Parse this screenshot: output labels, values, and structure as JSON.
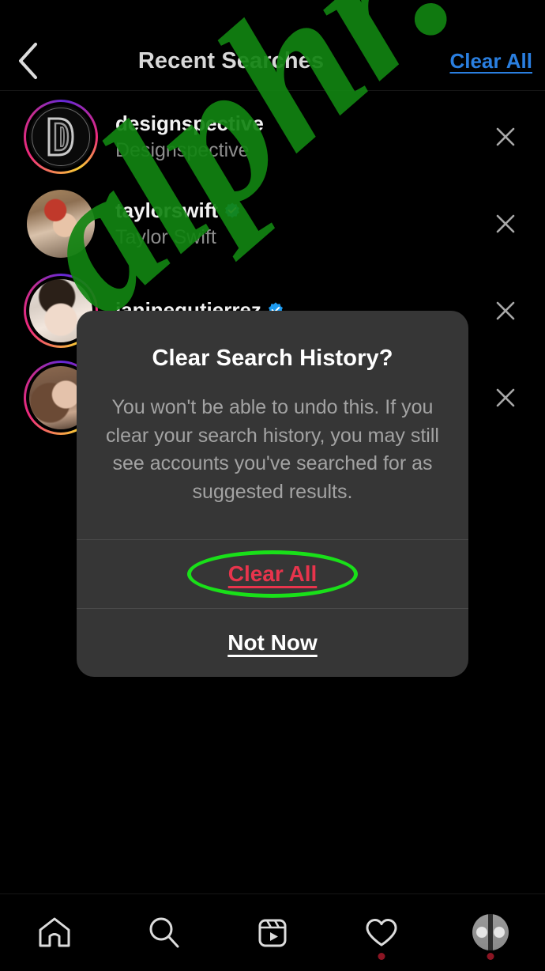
{
  "header": {
    "back_icon": "chevron-left-icon",
    "title": "Recent Searches",
    "clear_all_label": "Clear All",
    "clear_all_color": "#2a7fe0"
  },
  "search_list": {
    "remove_icon": "close-icon",
    "items": [
      {
        "username": "designspective",
        "fullname": "Designspective",
        "verified": false,
        "has_story_ring": true,
        "avatar_type": "logo-d"
      },
      {
        "username": "taylorswift",
        "fullname": "Taylor Swift",
        "verified": true,
        "has_story_ring": false,
        "avatar_type": "photo-taylor"
      },
      {
        "username": "janinegutierrez",
        "fullname": "",
        "verified": true,
        "has_story_ring": true,
        "avatar_type": "photo-janine"
      },
      {
        "username": "",
        "fullname": "",
        "verified": false,
        "has_story_ring": true,
        "avatar_type": "photo-fourth"
      }
    ]
  },
  "dialog": {
    "title": "Clear Search History?",
    "message": "You won't be able to undo this. If you clear your search history, you may still see accounts you've searched for as suggested results.",
    "confirm_label": "Clear All",
    "confirm_color": "#e8344c",
    "cancel_label": "Not Now",
    "cancel_color": "#ffffff"
  },
  "annotation": {
    "shape": "ellipse",
    "color": "#19e019",
    "targets": "Clear All"
  },
  "watermark": {
    "text": "alphr.com",
    "color": "#128412"
  },
  "bottom_nav": {
    "items": [
      {
        "icon": "home-icon",
        "badge": false
      },
      {
        "icon": "search-icon",
        "badge": false
      },
      {
        "icon": "reels-icon",
        "badge": false
      },
      {
        "icon": "heart-icon",
        "badge": true
      },
      {
        "icon": "profile-avatar-icon",
        "badge": true
      }
    ]
  }
}
